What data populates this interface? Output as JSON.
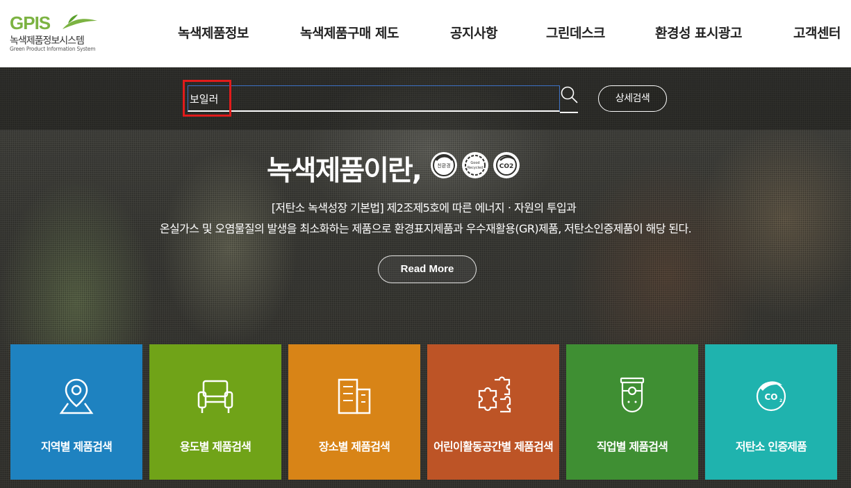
{
  "logo": {
    "brand": "GPIS",
    "name_ko": "녹색제품정보시스템",
    "name_en": "Green Product Information System"
  },
  "nav": {
    "items": [
      {
        "label": "녹색제품정보"
      },
      {
        "label": "녹색제품구매 제도"
      },
      {
        "label": "공지사항"
      },
      {
        "label": "그린데스크"
      },
      {
        "label": "환경성 표시광고"
      },
      {
        "label": "고객센터"
      }
    ]
  },
  "search": {
    "value": "보일러",
    "detail_label": "상세검색"
  },
  "hero": {
    "title": "녹색제품이란,",
    "badges": [
      "친환경",
      "Good Recycled",
      "CO2"
    ],
    "desc_line1": "[저탄소 녹색성장 기본법] 제2조제5호에 따른 에너지ㆍ자원의 투입과",
    "desc_line2": "온실가스 및 오염물질의 발생을 최소화하는 제품으로 환경표지제품과 우수재활용(GR)제품, 저탄소인증제품이 해당 된다.",
    "read_more": "Read More"
  },
  "tiles": [
    {
      "label": "지역별 제품검색",
      "icon": "map-pin-icon",
      "color": "#1e82c0"
    },
    {
      "label": "용도별 제품검색",
      "icon": "sofa-icon",
      "color": "#70a318"
    },
    {
      "label": "장소별 제품검색",
      "icon": "building-icon",
      "color": "#d88417"
    },
    {
      "label": "어린이활동공간별 제품검색",
      "icon": "puzzle-icon",
      "color": "#bd5426"
    },
    {
      "label": "직업별 제품검색",
      "icon": "worker-icon",
      "color": "#3f8f33"
    },
    {
      "label": "저탄소 인증제품",
      "icon": "co2-icon",
      "color": "#1fb3ae"
    }
  ]
}
